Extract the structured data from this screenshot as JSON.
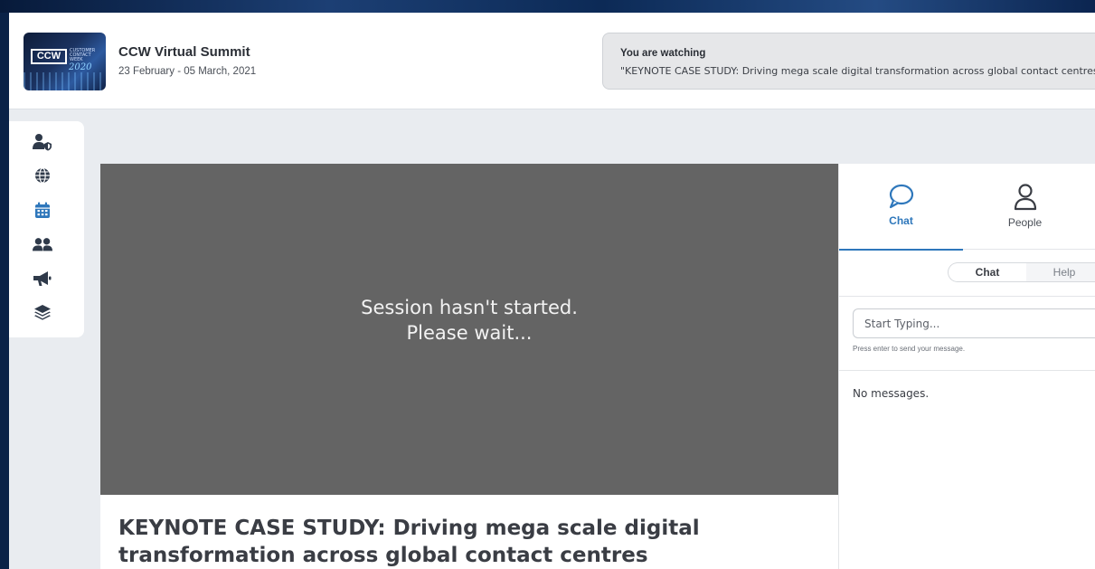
{
  "event": {
    "logo_text": "CCW",
    "logo_subtext": "CUSTOMER CONTACT WEEK",
    "logo_year": "2020",
    "title": "CCW Virtual Summit",
    "dates": "23 February - 05 March, 2021"
  },
  "now_watching": {
    "label": "You are watching",
    "title": "\"KEYNOTE CASE STUDY: Driving mega scale digital transformation across global contact centres\""
  },
  "sidebar": {
    "items": [
      {
        "icon": "user-shield-icon"
      },
      {
        "icon": "globe-icon"
      },
      {
        "icon": "calendar-icon"
      },
      {
        "icon": "users-icon"
      },
      {
        "icon": "megaphone-icon"
      },
      {
        "icon": "layers-icon"
      }
    ]
  },
  "video": {
    "status_line1": "Session hasn't started.",
    "status_line2": "Please wait..."
  },
  "session": {
    "title": "KEYNOTE CASE STUDY: Driving mega scale digital transformation across global contact centres"
  },
  "panel": {
    "tabs": [
      {
        "label": "Chat",
        "icon": "chat-bubble-icon",
        "active": true
      },
      {
        "label": "People",
        "icon": "person-icon",
        "active": false
      }
    ],
    "subtabs": {
      "chat": "Chat",
      "help": "Help"
    },
    "input_placeholder": "Start Typing...",
    "hint": "Press enter to send your message.",
    "empty_text": "No messages."
  },
  "colors": {
    "accent": "#2e77bb",
    "sidebar_icon": "#2f3a4a",
    "sidebar_active": "#2e77bb",
    "video_bg": "#646464",
    "page_bg": "#0a2247"
  }
}
